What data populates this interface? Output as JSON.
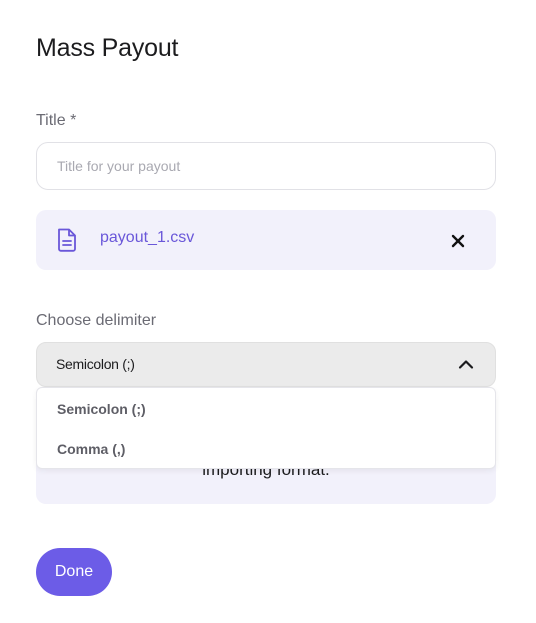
{
  "page": {
    "title": "Mass Payout"
  },
  "title_field": {
    "label": "Title *",
    "placeholder": "Title for your payout",
    "value": ""
  },
  "file": {
    "name": "payout_1.csv",
    "icon": "file-icon",
    "remove_icon": "close-icon"
  },
  "delimiter": {
    "label": "Choose delimiter",
    "selected": "Semicolon (;)",
    "expanded": true,
    "options": [
      "Semicolon (;)",
      "Comma (,)"
    ]
  },
  "info": {
    "text": "importing format."
  },
  "actions": {
    "done_label": "Done"
  },
  "colors": {
    "accent": "#6c5ce7",
    "file_text": "#6a57d9",
    "panel_bg": "#f2f1fb"
  }
}
